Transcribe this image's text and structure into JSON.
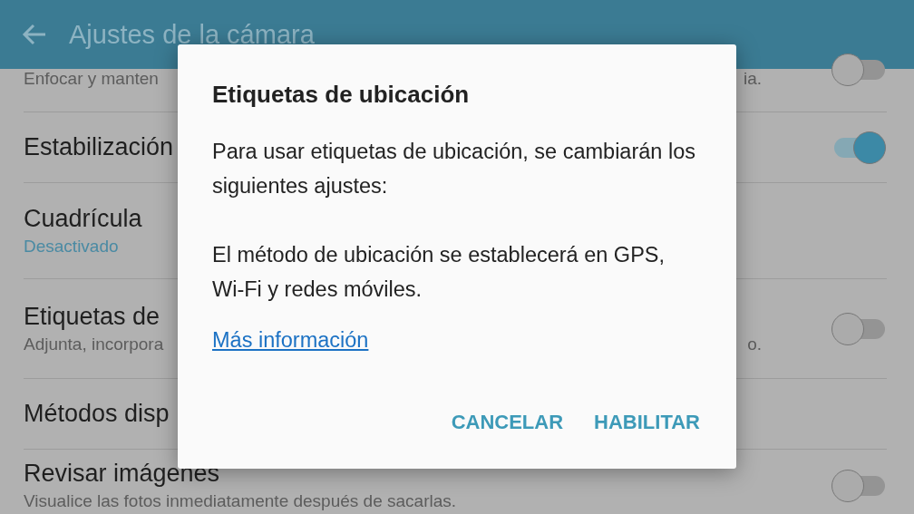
{
  "app_bar": {
    "title": "Ajustes de la cámara"
  },
  "settings": [
    {
      "kind": "switch",
      "subtitle": "Enfocar y manten",
      "subtitle_end": "ia.",
      "on": false
    },
    {
      "kind": "switch",
      "title": "Estabilización",
      "on": true
    },
    {
      "kind": "value",
      "title": "Cuadrícula",
      "subtitle": "Desactivado"
    },
    {
      "kind": "switch",
      "title": "Etiquetas de",
      "subtitle": "Adjunta, incorpora",
      "subtitle_end": "o.",
      "on": false
    },
    {
      "kind": "plain",
      "title": "Métodos disp"
    },
    {
      "kind": "switch",
      "title": "Revisar imágenes",
      "subtitle": "Visualice las fotos inmediatamente después de sacarlas.",
      "on": false
    }
  ],
  "dialog": {
    "title": "Etiquetas de ubicación",
    "paragraphs": [
      "Para usar etiquetas de ubicación, se cambiarán los siguientes ajustes:",
      "El método de ubicación se establecerá en GPS, Wi-Fi y redes móviles."
    ],
    "link": "Más información",
    "buttons": [
      "CANCELAR",
      "HABILITAR"
    ]
  }
}
